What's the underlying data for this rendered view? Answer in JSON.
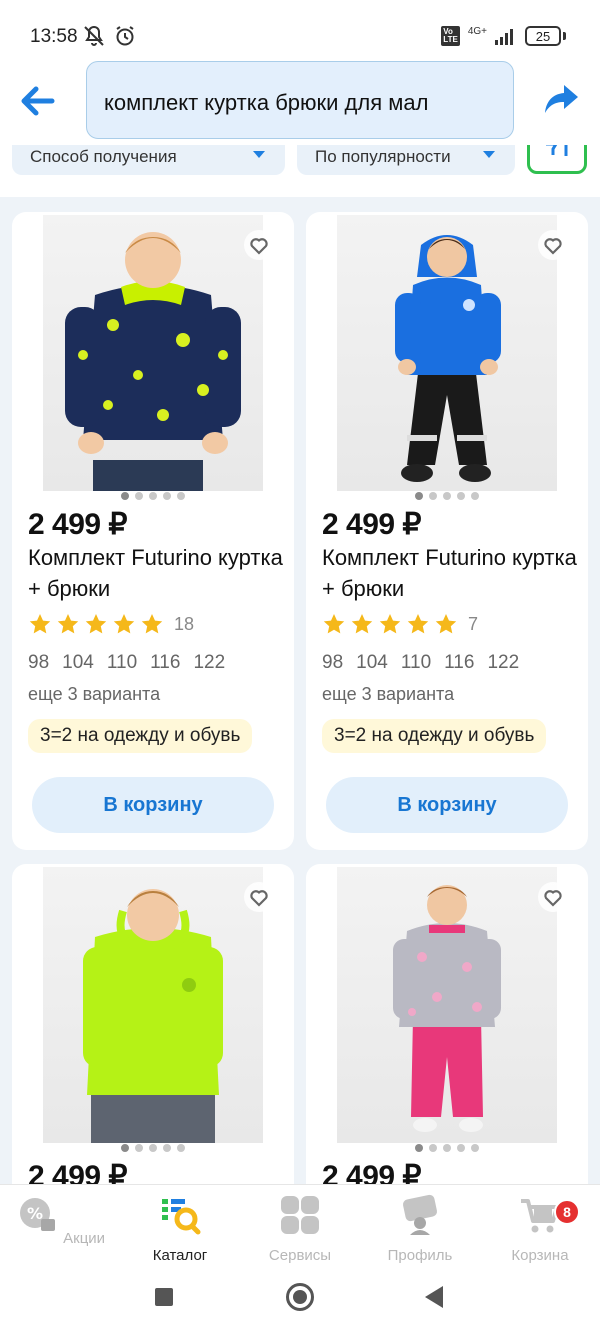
{
  "status_bar": {
    "time": "13:58",
    "battery": "25",
    "network": "4G+"
  },
  "header": {
    "search_value": "комплект куртка брюки для мал"
  },
  "filters": {
    "delivery_label": "Способ получения",
    "sort_label": "По популярности"
  },
  "colors": {
    "accent": "#1f7fe0",
    "filter_border": "#2fbf4f",
    "star": "#f5b81a",
    "badge": "#e53030"
  },
  "products": [
    {
      "price": "2 499 ₽",
      "title": "Комплект Futurino куртка + брюки",
      "rating_count": "18",
      "sizes": [
        "98",
        "104",
        "110",
        "116",
        "122"
      ],
      "variants": "еще 3 варианта",
      "promo": "3=2 на одежду и обувь",
      "cart_label": "В корзину"
    },
    {
      "price": "2 499 ₽",
      "title": "Комплект Futurino куртка + брюки",
      "rating_count": "7",
      "sizes": [
        "98",
        "104",
        "110",
        "116",
        "122"
      ],
      "variants": "еще 3 варианта",
      "promo": "3=2 на одежду и обувь",
      "cart_label": "В корзину"
    },
    {
      "price": "2 499 ₽"
    },
    {
      "price": "2 499 ₽"
    }
  ],
  "bottom_nav": {
    "items": [
      {
        "label": "Акции",
        "icon": "percent-tag-icon"
      },
      {
        "label": "Каталог",
        "icon": "catalog-search-icon"
      },
      {
        "label": "Сервисы",
        "icon": "services-grid-icon"
      },
      {
        "label": "Профиль",
        "icon": "profile-card-icon"
      },
      {
        "label": "Корзина",
        "icon": "cart-icon"
      }
    ],
    "cart_badge": "8"
  }
}
